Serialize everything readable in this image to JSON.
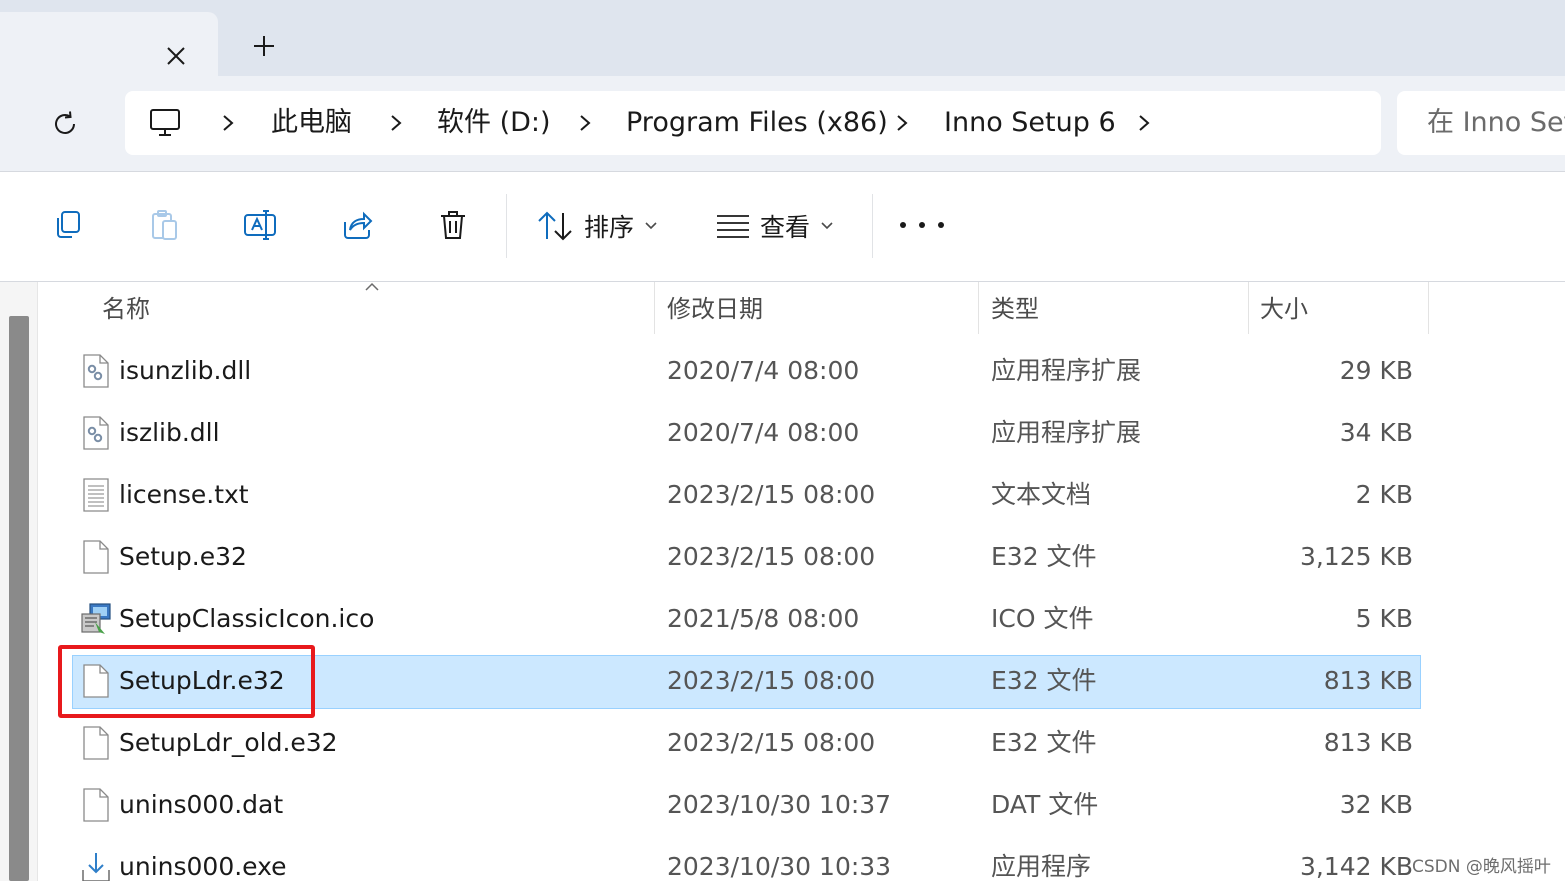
{
  "window": {
    "tab_title": "",
    "new_tab_label": "+"
  },
  "address": {
    "breadcrumbs": [
      "此电脑",
      "软件 (D:)",
      "Program Files (x86)",
      "Inno Setup 6"
    ],
    "search_placeholder": "在 Inno Set"
  },
  "commands": {
    "sort_label": "排序",
    "view_label": "查看"
  },
  "columns": {
    "name": "名称",
    "date": "修改日期",
    "type": "类型",
    "size": "大小"
  },
  "files": [
    {
      "name": "isunzlib.dll",
      "date": "2020/7/4 08:00",
      "type": "应用程序扩展",
      "size": "29 KB",
      "icon": "dll-file-icon"
    },
    {
      "name": "iszlib.dll",
      "date": "2020/7/4 08:00",
      "type": "应用程序扩展",
      "size": "34 KB",
      "icon": "dll-file-icon"
    },
    {
      "name": "license.txt",
      "date": "2023/2/15 08:00",
      "type": "文本文档",
      "size": "2 KB",
      "icon": "text-file-icon"
    },
    {
      "name": "Setup.e32",
      "date": "2023/2/15 08:00",
      "type": "E32 文件",
      "size": "3,125 KB",
      "icon": "blank-file-icon"
    },
    {
      "name": "SetupClassicIcon.ico",
      "date": "2021/5/8 08:00",
      "type": "ICO 文件",
      "size": "5 KB",
      "icon": "ico-file-icon"
    },
    {
      "name": "SetupLdr.e32",
      "date": "2023/2/15 08:00",
      "type": "E32 文件",
      "size": "813 KB",
      "icon": "blank-file-icon",
      "selected": true
    },
    {
      "name": "SetupLdr_old.e32",
      "date": "2023/2/15 08:00",
      "type": "E32 文件",
      "size": "813 KB",
      "icon": "blank-file-icon"
    },
    {
      "name": "unins000.dat",
      "date": "2023/10/30 10:37",
      "type": "DAT 文件",
      "size": "32 KB",
      "icon": "blank-file-icon"
    },
    {
      "name": "unins000.exe",
      "date": "2023/10/30 10:33",
      "type": "应用程序",
      "size": "3,142 KB",
      "icon": "installer-file-icon"
    }
  ],
  "watermark": "CSDN @晚风摇叶",
  "colors": {
    "selection_fill": "#cce8ff",
    "selection_border": "#99d1ff",
    "annotation_red": "#e8191c",
    "chrome_bg": "#eef1f6",
    "tabstrip_bg": "#dfe5ee"
  }
}
